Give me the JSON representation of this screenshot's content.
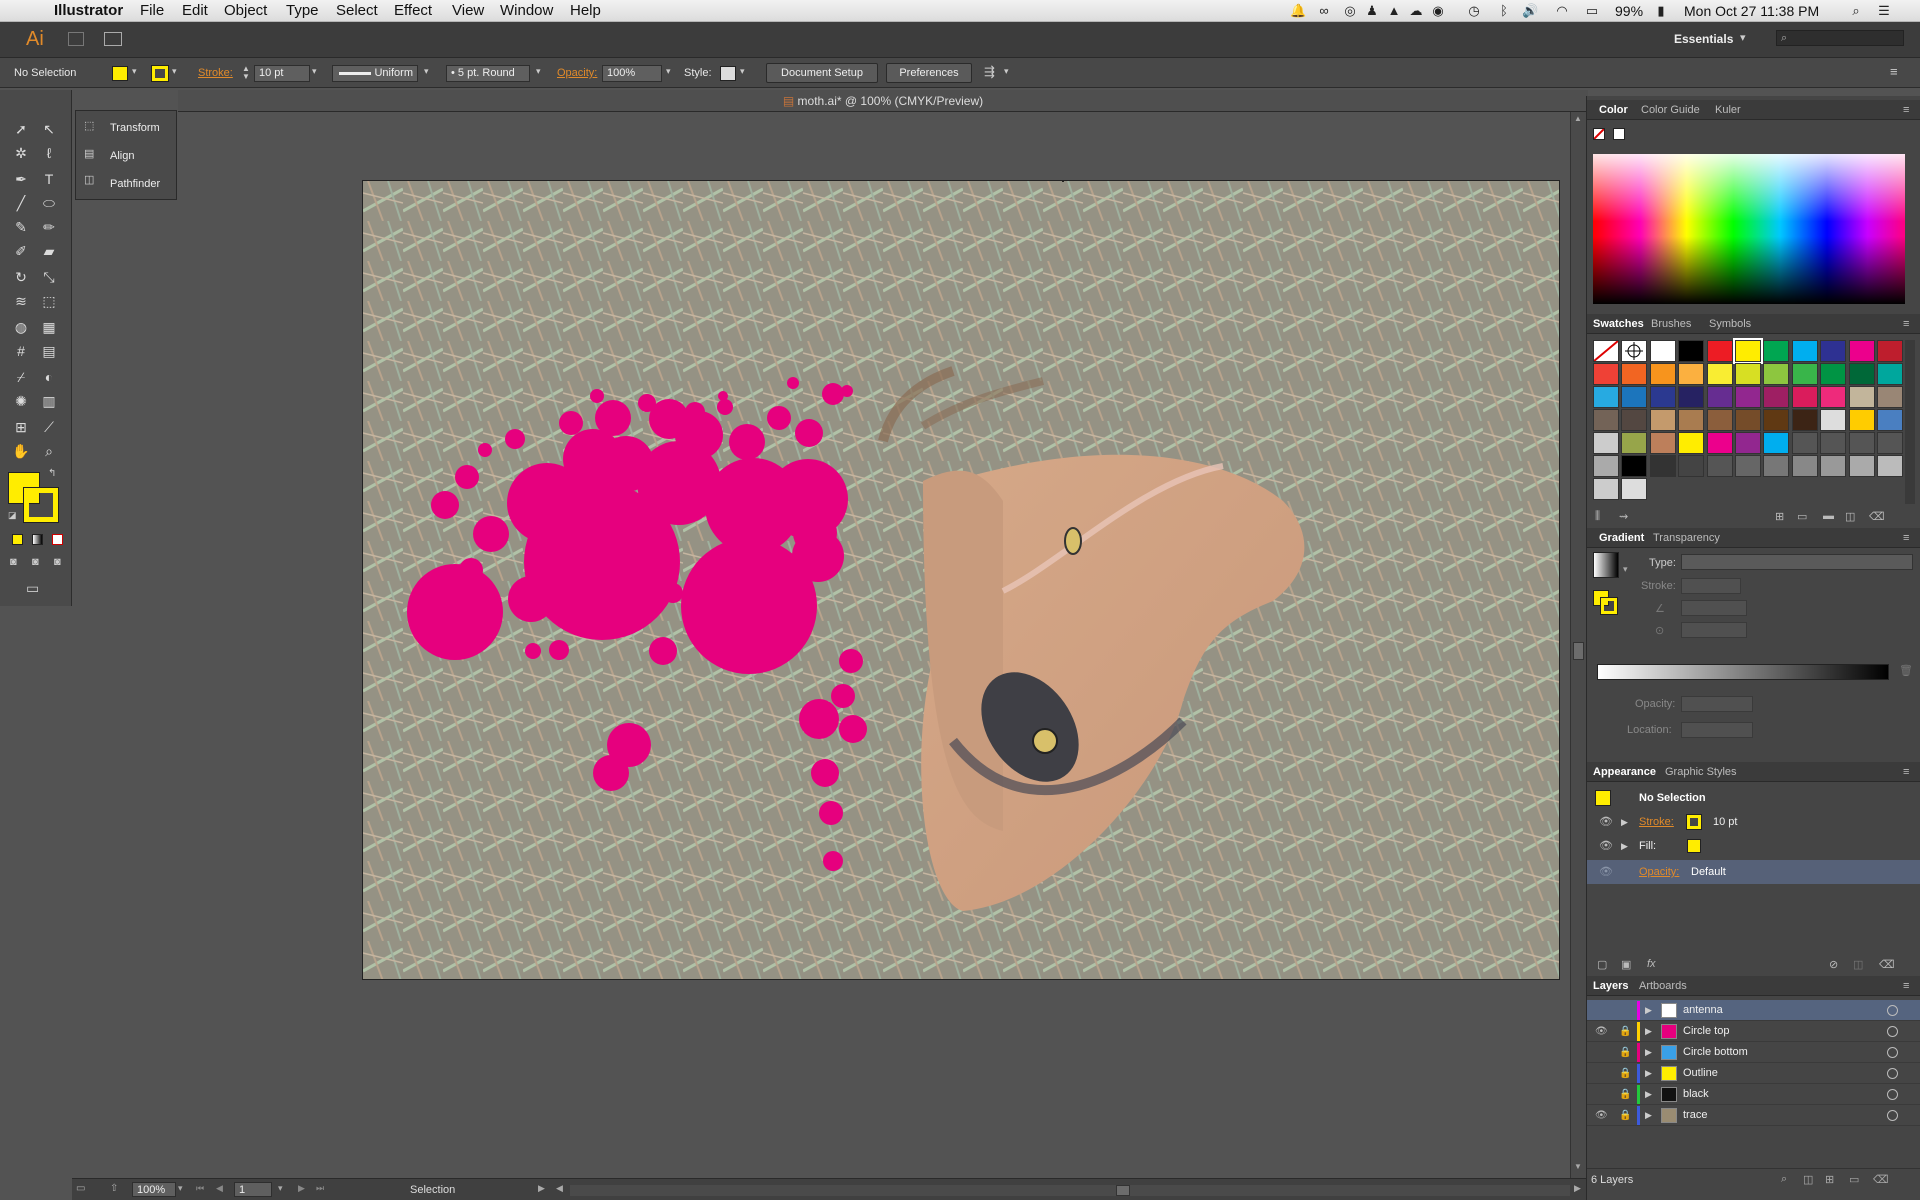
{
  "menubar": {
    "app": "Illustrator",
    "items": [
      "File",
      "Edit",
      "Object",
      "Type",
      "Select",
      "Effect",
      "View",
      "Window",
      "Help"
    ],
    "battery": "99%",
    "clock": "Mon Oct 27  11:38 PM"
  },
  "appbar": {
    "logo": "Ai",
    "workspace": "Essentials"
  },
  "control": {
    "selection": "No Selection",
    "stroke_label": "Stroke:",
    "stroke_weight": "10 pt",
    "profile": "Uniform",
    "brush": "5 pt. Round",
    "opacity_label": "Opacity:",
    "opacity_value": "100%",
    "style_label": "Style:",
    "document_setup": "Document Setup",
    "preferences": "Preferences"
  },
  "flyout": {
    "items": [
      "Transform",
      "Align",
      "Pathfinder"
    ]
  },
  "document": {
    "tab_title": "moth.ai* @ 100% (CMYK/Preview)"
  },
  "colors": {
    "accent_yellow": "#ffed00",
    "circle_pink": "#e6007e",
    "orange_label": "#e08a2a"
  },
  "panels": {
    "color_tabs": [
      "Color",
      "Color Guide",
      "Kuler"
    ],
    "swatch_tabs": [
      "Swatches",
      "Brushes",
      "Symbols"
    ],
    "gradient_tabs": [
      "Gradient",
      "Transparency"
    ],
    "gradient": {
      "type_label": "Type:",
      "stroke_label": "Stroke:",
      "opacity_label": "Opacity:",
      "location_label": "Location:"
    },
    "appearance_tabs": [
      "Appearance",
      "Graphic Styles"
    ],
    "appearance": {
      "title": "No Selection",
      "stroke_label": "Stroke:",
      "stroke_value": "10 pt",
      "fill_label": "Fill:",
      "opacity_label": "Opacity:",
      "opacity_value": "Default"
    },
    "layer_tabs": [
      "Layers",
      "Artboards"
    ],
    "layers": [
      "antenna",
      "Circle top",
      "Circle bottom",
      "Outline",
      "black",
      "trace"
    ],
    "layers_count": "6 Layers"
  },
  "status": {
    "zoom": "100%",
    "page": "1",
    "tool": "Selection"
  }
}
